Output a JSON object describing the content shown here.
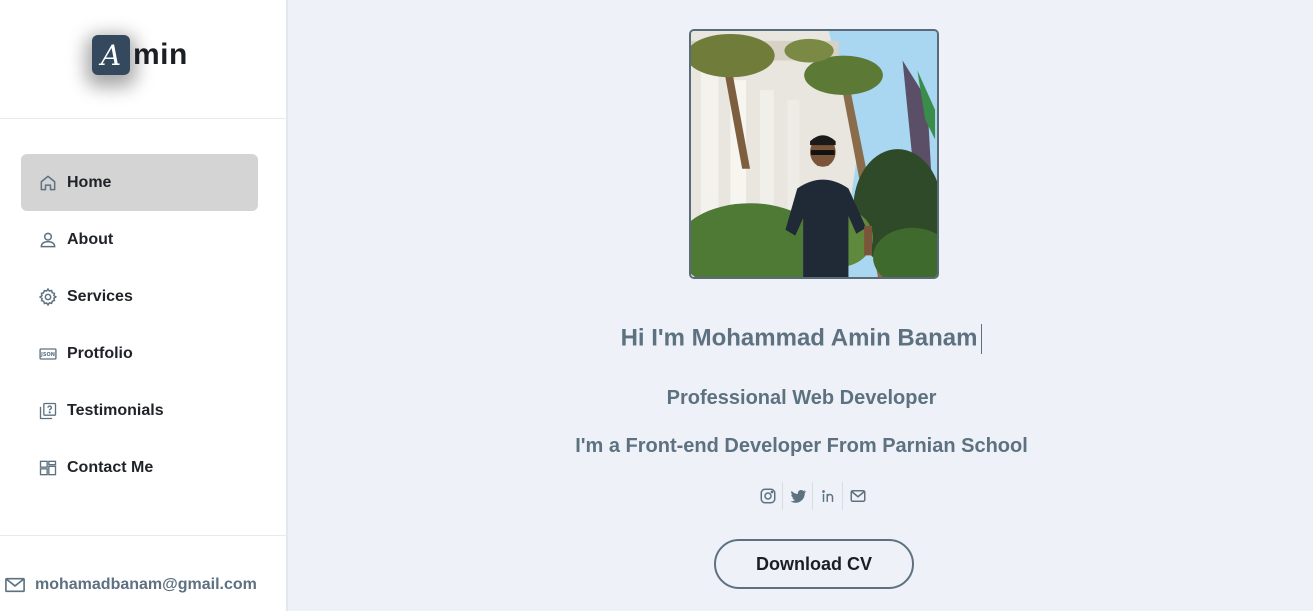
{
  "brand": {
    "badge_letter": "A",
    "text": "min"
  },
  "nav": {
    "items": [
      {
        "label": "Home",
        "icon": "home-icon",
        "active": true
      },
      {
        "label": "About",
        "icon": "user-icon",
        "active": false
      },
      {
        "label": "Services",
        "icon": "gear-icon",
        "active": false
      },
      {
        "label": "Protfolio",
        "icon": "json-file-icon",
        "active": false
      },
      {
        "label": "Testimonials",
        "icon": "question-box-icon",
        "active": false
      },
      {
        "label": "Contact Me",
        "icon": "dashboard-icon",
        "active": false
      }
    ]
  },
  "sidebar_footer": {
    "email": "mohamadbanam@gmail.com",
    "icon": "mail-icon"
  },
  "hero": {
    "greeting": "Hi I'm Mohammad Amin Banam",
    "role": "Professional Web Developer",
    "intro": "I'm a Front-end Developer From Parnian School",
    "socials": [
      {
        "icon": "instagram-icon"
      },
      {
        "icon": "twitter-icon"
      },
      {
        "icon": "linkedin-icon"
      },
      {
        "icon": "mail-icon"
      }
    ],
    "cta_label": "Download CV"
  },
  "colors": {
    "accent": "#5d7180",
    "badge": "#34495e",
    "active_nav": "#d4d4d4",
    "page_bg": "#eef2f8"
  }
}
